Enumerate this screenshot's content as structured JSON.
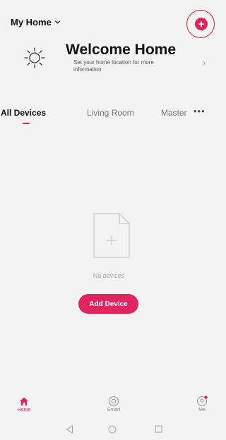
{
  "header": {
    "home_label": "My Home",
    "add_icon": "plus-circle-icon",
    "accent_color": "#e0245e"
  },
  "welcome": {
    "title": "Welcome Home",
    "subtitle": "Set your home location for more information",
    "icon": "sun-icon"
  },
  "tabs": {
    "items": [
      {
        "label": "All Devices",
        "active": true
      },
      {
        "label": "Living Room",
        "active": false
      },
      {
        "label": "Master",
        "active": false
      }
    ],
    "more_label": "•••"
  },
  "empty_state": {
    "icon": "blank-file-plus-icon",
    "message": "No devices",
    "button_label": "Add Device"
  },
  "bottom_nav": {
    "items": [
      {
        "label": "Home",
        "icon": "home-icon",
        "active": true
      },
      {
        "label": "Smart",
        "icon": "smart-icon",
        "active": false
      },
      {
        "label": "Me",
        "icon": "me-icon",
        "active": false
      }
    ]
  },
  "system_nav": {
    "back_icon": "back-triangle-icon",
    "home_icon": "home-circle-icon",
    "recents_icon": "recents-square-icon"
  }
}
